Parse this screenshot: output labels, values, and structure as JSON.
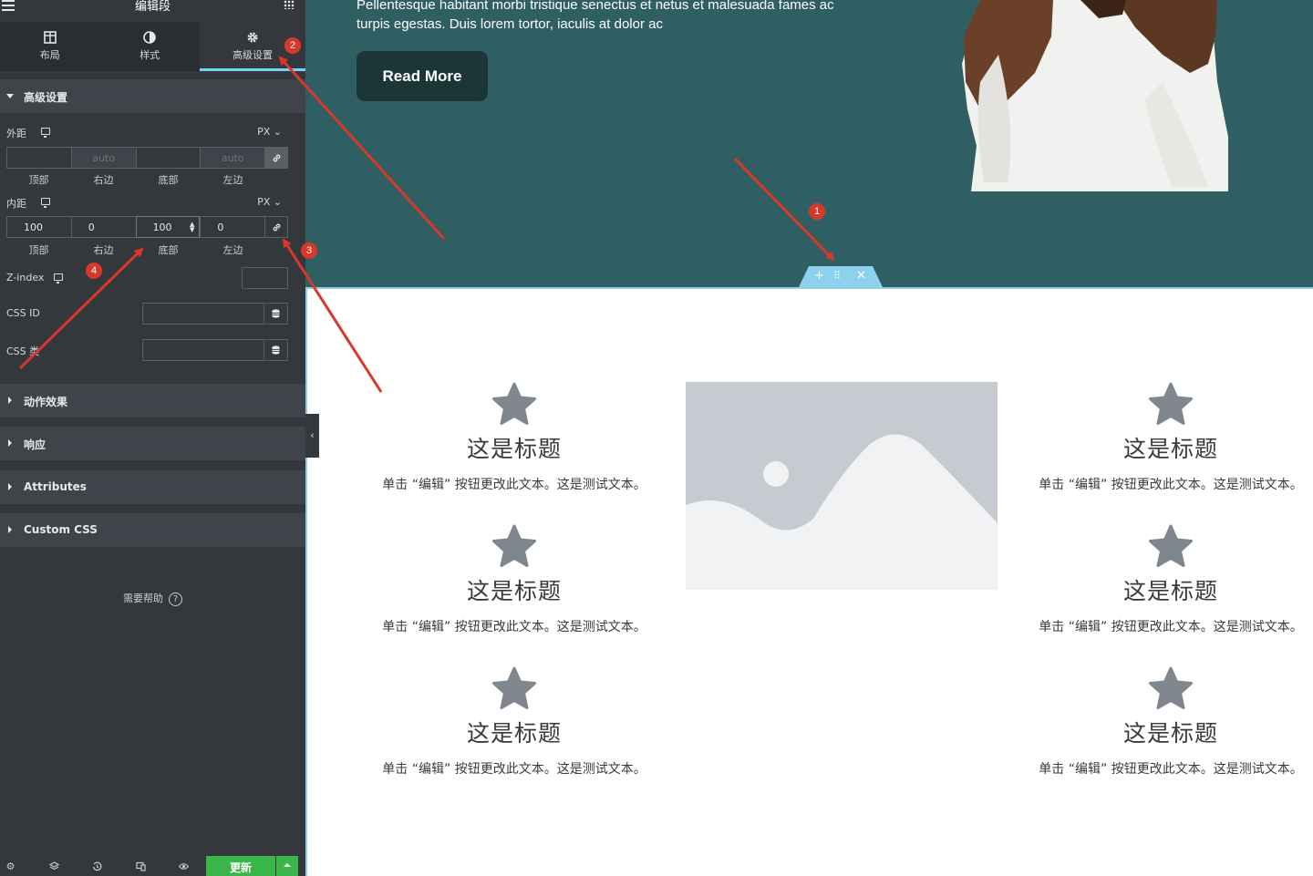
{
  "panel": {
    "title": "编辑段",
    "tabs": [
      {
        "label": "布局",
        "icon": "layout-icon"
      },
      {
        "label": "样式",
        "icon": "contrast-icon"
      },
      {
        "label": "高级设置",
        "icon": "gear-icon"
      }
    ],
    "advanced_section": "高级设置",
    "margin": {
      "label": "外距",
      "unit": "PX",
      "values": [
        "",
        "auto",
        "",
        "auto"
      ],
      "sides": [
        "顶部",
        "右边",
        "底部",
        "左边"
      ]
    },
    "padding": {
      "label": "内距",
      "unit": "PX",
      "values": [
        "100",
        "0",
        "100",
        "0"
      ],
      "sides": [
        "顶部",
        "右边",
        "底部",
        "左边"
      ]
    },
    "zindex_label": "Z-index",
    "cssid_label": "CSS ID",
    "cssclass_label": "CSS 类",
    "collapsed_sections": [
      "动作效果",
      "响应",
      "Attributes",
      "Custom CSS"
    ],
    "help_text": "需要帮助",
    "update_label": "更新"
  },
  "hero": {
    "text": "Pellentesque habitant morbi tristique senectus et netus et malesuada fames ac turpis egestas. Duis lorem tortor, iaculis at dolor ac",
    "button_label": "Read More"
  },
  "features": {
    "title": "这是标题",
    "desc": "单击 “编辑” 按钮更改此文本。这是测试文本。"
  },
  "annotations": [
    "1",
    "2",
    "3",
    "4"
  ],
  "colors": {
    "panel_bg": "#34383c",
    "hero_bg": "#2f5f63",
    "accent": "#71d7f7",
    "annotation": "#d8382a",
    "update": "#39b54a"
  }
}
